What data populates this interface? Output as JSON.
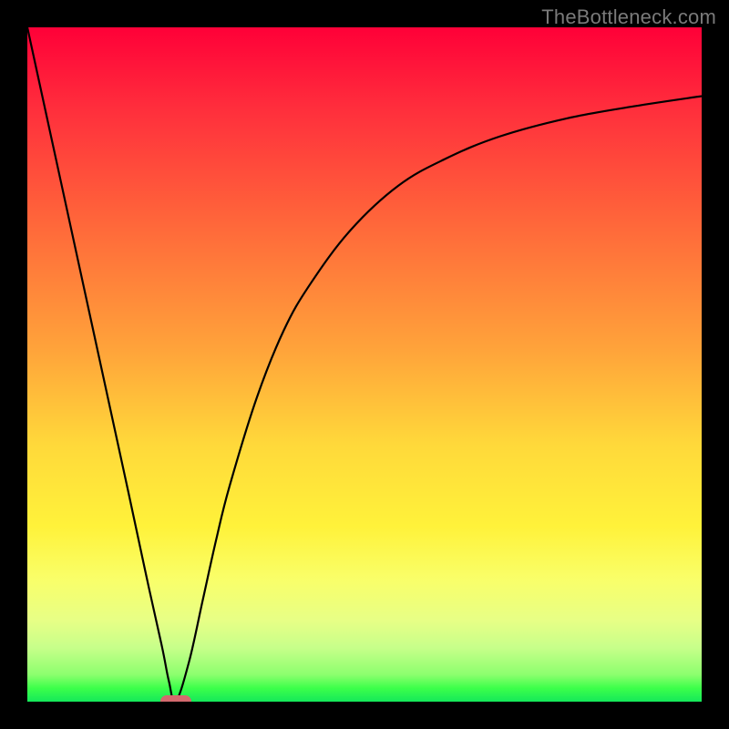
{
  "watermark": "TheBottleneck.com",
  "colors": {
    "frame": "#000000",
    "curve": "#000000",
    "marker": "#d46a6e",
    "gradient_top": "#ff0038",
    "gradient_bottom": "#14e85a"
  },
  "chart_data": {
    "type": "line",
    "title": "",
    "xlabel": "",
    "ylabel": "",
    "xlim": [
      0,
      100
    ],
    "ylim": [
      0,
      100
    ],
    "series": [
      {
        "name": "curve",
        "x": [
          0,
          5,
          10,
          15,
          18,
          20,
          21,
          22,
          24,
          26,
          28,
          30,
          34,
          38,
          42,
          48,
          55,
          62,
          70,
          80,
          90,
          100
        ],
        "y": [
          100,
          77,
          54,
          31,
          17,
          8,
          3,
          0,
          6,
          15,
          24,
          32,
          45,
          55,
          62,
          70,
          76.5,
          80.5,
          83.8,
          86.5,
          88.3,
          89.8
        ]
      }
    ],
    "annotations": [
      {
        "name": "min-marker",
        "x": 22,
        "y": 0
      }
    ],
    "grid": false,
    "legend": false
  }
}
